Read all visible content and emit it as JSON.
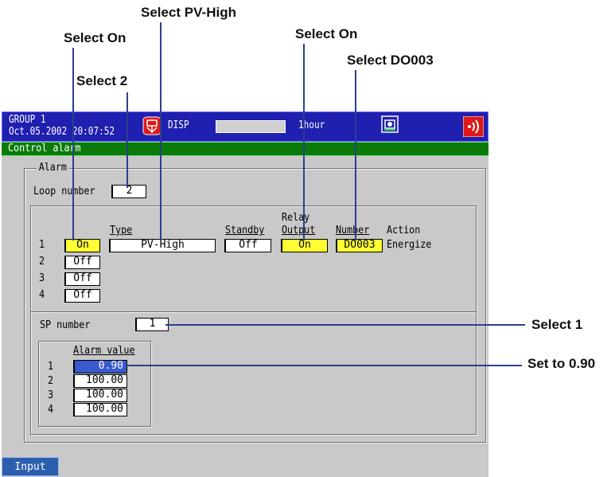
{
  "callouts": {
    "select_pv_high": "Select PV-High",
    "select_on_1": "Select On",
    "select_on_2": "Select On",
    "select_do003": "Select DO003",
    "select_2": "Select 2",
    "select_1": "Select 1",
    "set_to": "Set to 0.90"
  },
  "header": {
    "group": "GROUP 1",
    "datetime": "Oct.05.2002 20:07:52",
    "disp": "DISP",
    "interval": "1hour"
  },
  "status": {
    "title": "Control alarm"
  },
  "alarm": {
    "frame_label": "Alarm",
    "loop_number_label": "Loop number",
    "loop_number_value": "2",
    "col_type": "Type",
    "col_standby": "Standby",
    "col_relay": "Relay",
    "col_output": "Output",
    "col_number": "Number",
    "col_action": "Action",
    "rows": [
      {
        "index": "1",
        "onoff": "On",
        "type": "PV-High",
        "standby": "Off",
        "output": "On",
        "number": "DO003",
        "action": "Energize"
      },
      {
        "index": "2",
        "onoff": "Off"
      },
      {
        "index": "3",
        "onoff": "Off"
      },
      {
        "index": "4",
        "onoff": "Off"
      }
    ],
    "sp_number_label": "SP number",
    "sp_number_value": "1",
    "alarm_value_label": "Alarm value",
    "values": [
      {
        "index": "1",
        "value": "0.90"
      },
      {
        "index": "2",
        "value": "100.00"
      },
      {
        "index": "3",
        "value": "100.00"
      },
      {
        "index": "4",
        "value": "100.00"
      }
    ]
  },
  "footer": {
    "input_label": "Input"
  },
  "colors": {
    "title_bar": "#1f1fb0",
    "status_bar": "#0a7b0a",
    "highlight": "#ffff33",
    "selected": "#3a5ad0"
  }
}
